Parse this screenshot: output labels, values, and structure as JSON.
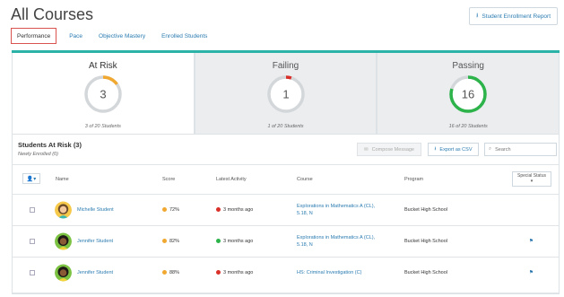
{
  "page": {
    "title": "All Courses",
    "report_button": "Student Enrollment Report",
    "download_icon": "download-icon"
  },
  "tabs": [
    {
      "label": "Performance",
      "active": true
    },
    {
      "label": "Pace",
      "active": false
    },
    {
      "label": "Objective Mastery",
      "active": false
    },
    {
      "label": "Enrolled Students",
      "active": false
    }
  ],
  "summary": {
    "at_risk": {
      "title": "At Risk",
      "count": "3",
      "caption": "3 of 20 Students",
      "fraction": 0.15,
      "color": "#f0a830"
    },
    "failing": {
      "title": "Failing",
      "count": "1",
      "caption": "1 of 20 Students",
      "fraction": 0.05,
      "color": "#d9302a"
    },
    "passing": {
      "title": "Passing",
      "count": "16",
      "caption": "16 of 20 Students",
      "fraction": 0.8,
      "color": "#2cb34a"
    },
    "accent_color": "#2ab3a6"
  },
  "panel": {
    "heading": "Students At Risk (3)",
    "subheading": "Newly Enrolled (0)",
    "compose_button": "Compose Message",
    "export_button": "Export as CSV",
    "search_placeholder": "Search"
  },
  "table": {
    "columns": {
      "name": "Name",
      "score": "Score",
      "activity": "Latest Activity",
      "course": "Course",
      "program": "Program",
      "special_status": "Special Status"
    },
    "rows": [
      {
        "name": "Michelle Student",
        "score": "72%",
        "score_color": "#f0a830",
        "activity": "3 months ago",
        "activity_color": "#d9302a",
        "course_line1": "Explorations in Mathematics A (CL),",
        "course_line2": "5.18, N",
        "program": "Bucket High School",
        "flag": false
      },
      {
        "name": "Jennifer Student",
        "score": "82%",
        "score_color": "#f0a830",
        "activity": "3 months ago",
        "activity_color": "#2cb34a",
        "course_line1": "Explorations in Mathematics A (CL),",
        "course_line2": "5.18, N",
        "program": "Bucket High School",
        "flag": true
      },
      {
        "name": "Jennifer Student",
        "score": "88%",
        "score_color": "#f0a830",
        "activity": "3 months ago",
        "activity_color": "#d9302a",
        "course_line1": "HS: Criminal Investigation (C)",
        "course_line2": "",
        "program": "Bucket High School",
        "flag": true
      }
    ]
  }
}
